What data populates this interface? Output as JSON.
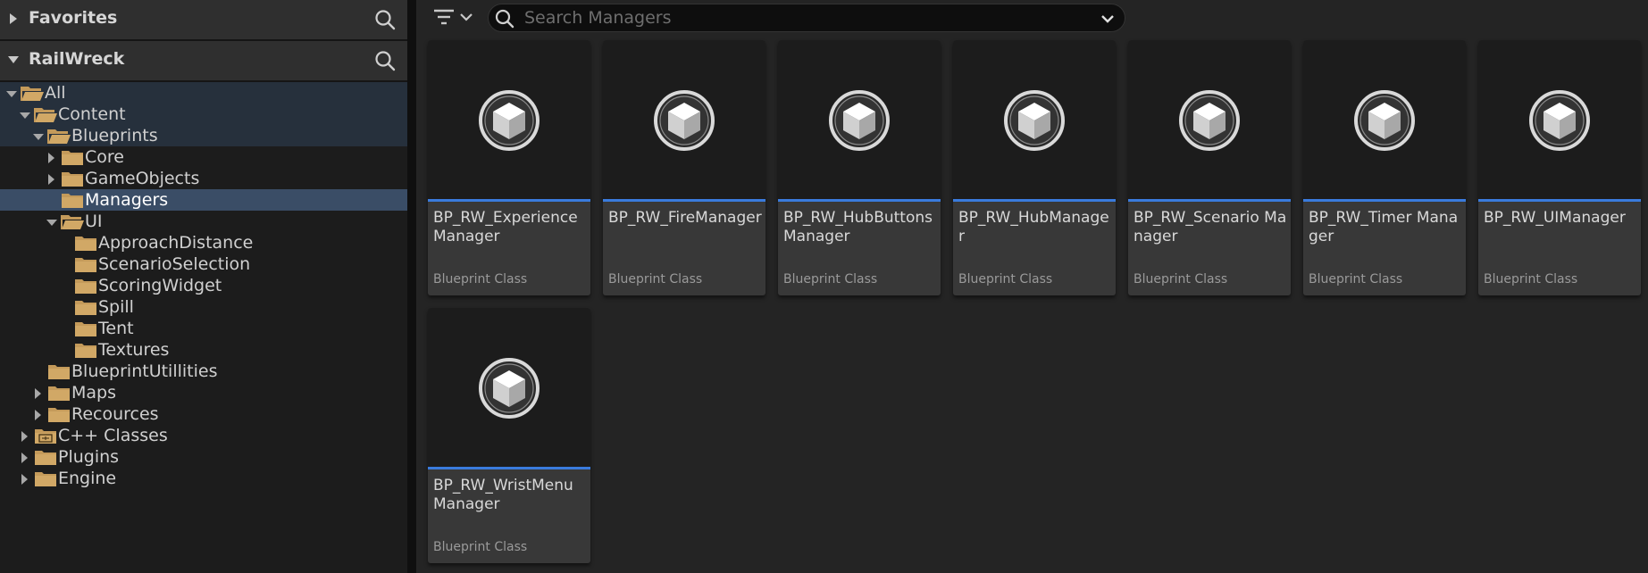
{
  "favorites": {
    "title": "Favorites"
  },
  "project": {
    "title": "RailWreck"
  },
  "tree": [
    {
      "label": "All",
      "state": "hl"
    },
    {
      "label": "Content",
      "state": "hl"
    },
    {
      "label": "Blueprints",
      "state": "hl"
    },
    {
      "label": "Core",
      "state": ""
    },
    {
      "label": "GameObjects",
      "state": ""
    },
    {
      "label": "Managers",
      "state": "sel"
    },
    {
      "label": "UI",
      "state": ""
    },
    {
      "label": "ApproachDistance",
      "state": ""
    },
    {
      "label": "ScenarioSelection",
      "state": ""
    },
    {
      "label": "ScoringWidget",
      "state": ""
    },
    {
      "label": "Spill",
      "state": ""
    },
    {
      "label": "Tent",
      "state": ""
    },
    {
      "label": "Textures",
      "state": ""
    },
    {
      "label": "BlueprintUtillities",
      "state": ""
    },
    {
      "label": "Maps",
      "state": ""
    },
    {
      "label": "Recources",
      "state": ""
    },
    {
      "label": "C++ Classes",
      "state": ""
    },
    {
      "label": "Plugins",
      "state": ""
    },
    {
      "label": "Engine",
      "state": ""
    }
  ],
  "search": {
    "placeholder": "Search Managers",
    "value": ""
  },
  "assets": [
    {
      "name": "BP_RW_Experience Manager",
      "type": "Blueprint Class"
    },
    {
      "name": "BP_RW_FireManager",
      "type": "Blueprint Class"
    },
    {
      "name": "BP_RW_HubButtons Manager",
      "type": "Blueprint Class"
    },
    {
      "name": "BP_RW_HubManager",
      "type": "Blueprint Class"
    },
    {
      "name": "BP_RW_Scenario Manager",
      "type": "Blueprint Class"
    },
    {
      "name": "BP_RW_Timer Manager",
      "type": "Blueprint Class"
    },
    {
      "name": "BP_RW_UIManager",
      "type": "Blueprint Class"
    },
    {
      "name": "BP_RW_WristMenu Manager",
      "type": "Blueprint Class"
    }
  ],
  "colors": {
    "accent": "#3a7bdd",
    "selection": "#3a4d66",
    "folder": "#c49a5a"
  },
  "icons": [
    "chevron-right-icon",
    "chevron-down-icon",
    "search-icon",
    "folder-icon",
    "folder-open-icon",
    "cpp-folder-icon",
    "filter-icon",
    "blueprint-cube-icon"
  ]
}
